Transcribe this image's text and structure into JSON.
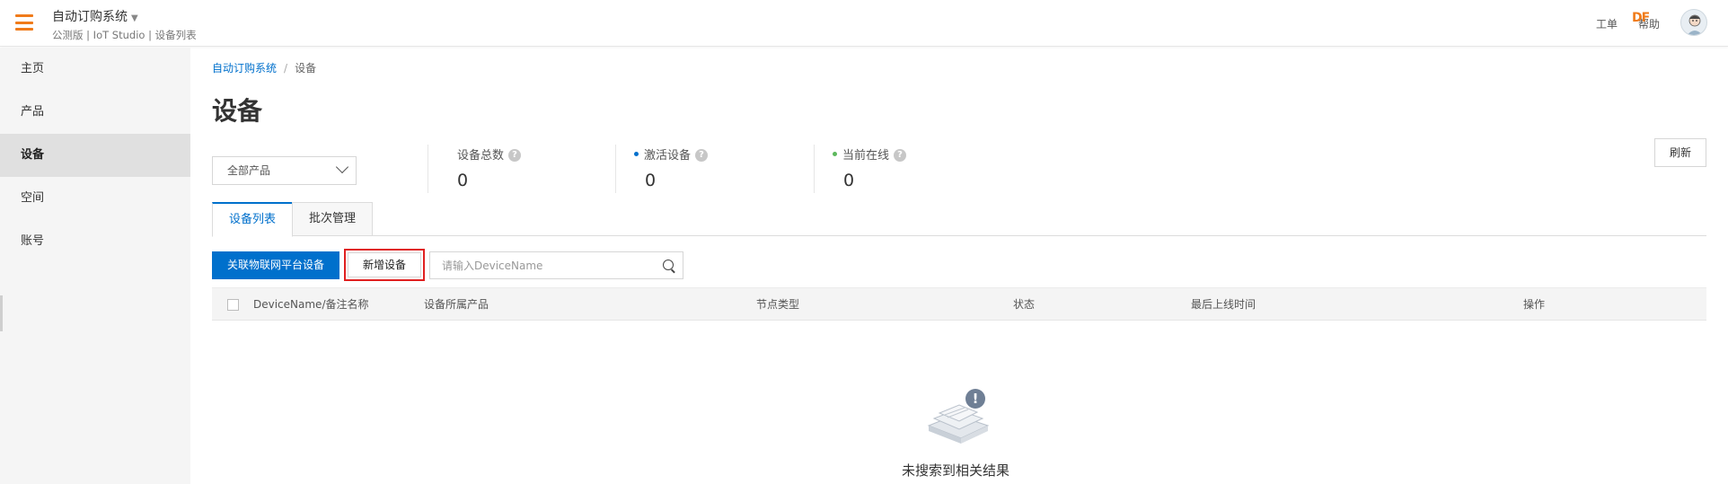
{
  "header": {
    "app_title": "自动订购系统",
    "app_subtitle": "公测版 | IoT Studio | 设备列表",
    "ticket_label": "工单",
    "help_label": "帮助",
    "df_badge": "DF",
    "accent_color": "#f07b1a"
  },
  "sidebar": {
    "items": [
      {
        "label": "主页"
      },
      {
        "label": "产品"
      },
      {
        "label": "设备",
        "active": true
      },
      {
        "label": "空间"
      },
      {
        "label": "账号"
      }
    ]
  },
  "breadcrumb": {
    "root": "自动订购系统",
    "separator": "/",
    "current": "设备"
  },
  "page": {
    "title": "设备"
  },
  "filter": {
    "product_select_value": "全部产品"
  },
  "stats": [
    {
      "label": "设备总数",
      "value": "0",
      "dot_color": ""
    },
    {
      "label": "激活设备",
      "value": "0",
      "dot_color": "#0070cc"
    },
    {
      "label": "当前在线",
      "value": "0",
      "dot_color": "#5cb85c"
    }
  ],
  "refresh_label": "刷新",
  "tabs": [
    {
      "label": "设备列表",
      "active": true
    },
    {
      "label": "批次管理",
      "active": false
    }
  ],
  "actions": {
    "link_platform_label": "关联物联网平台设备",
    "add_device_label": "新增设备",
    "search_placeholder": "请输入DeviceName",
    "primary_color": "#0070cc",
    "highlight_color": "#e02020"
  },
  "table": {
    "columns": [
      "DeviceName/备注名称",
      "设备所属产品",
      "节点类型",
      "状态",
      "最后上线时间",
      "操作"
    ]
  },
  "empty": {
    "message": "未搜索到相关结果",
    "icon_glyph": "!"
  }
}
